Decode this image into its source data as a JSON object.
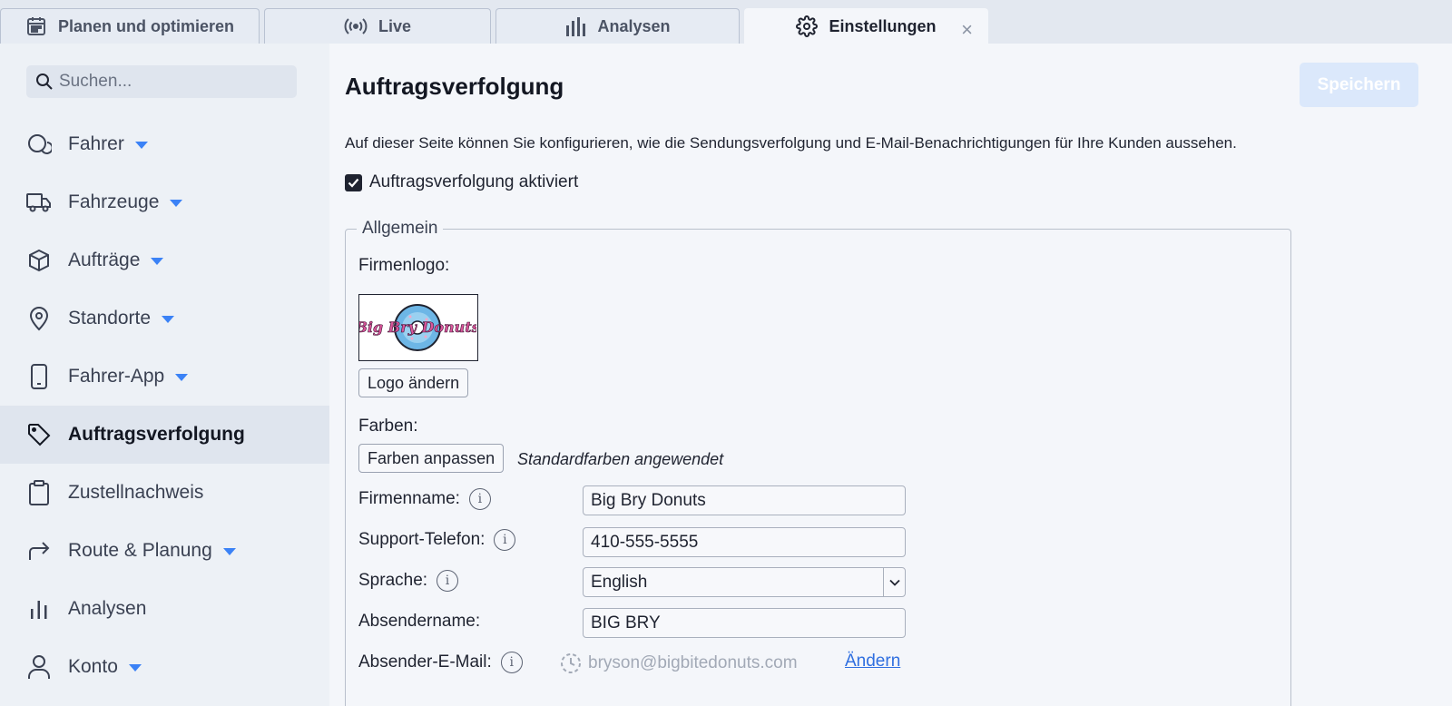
{
  "tabs": [
    {
      "label": "Planen und optimieren",
      "icon": "calendar-icon"
    },
    {
      "label": "Live",
      "icon": "broadcast-icon"
    },
    {
      "label": "Analysen",
      "icon": "bar-chart-icon"
    },
    {
      "label": "Einstellungen",
      "icon": "gear-icon",
      "active": true,
      "close": "×"
    }
  ],
  "sidebar": {
    "search_placeholder": "Suchen...",
    "items": [
      {
        "label": "Fahrer",
        "icon": "driver-icon",
        "expandable": true
      },
      {
        "label": "Fahrzeuge",
        "icon": "truck-icon",
        "expandable": true
      },
      {
        "label": "Aufträge",
        "icon": "box-icon",
        "expandable": true
      },
      {
        "label": "Standorte",
        "icon": "map-pin-icon",
        "expandable": true
      },
      {
        "label": "Fahrer-App",
        "icon": "phone-icon",
        "expandable": true
      },
      {
        "label": "Auftragsverfolgung",
        "icon": "tag-icon",
        "active": true
      },
      {
        "label": "Zustellnachweis",
        "icon": "clipboard-icon"
      },
      {
        "label": "Route & Planung",
        "icon": "route-arrow-icon",
        "expandable": true
      },
      {
        "label": "Analysen",
        "icon": "bar-chart-icon"
      },
      {
        "label": "Konto",
        "icon": "user-icon",
        "expandable": true
      }
    ]
  },
  "main": {
    "title": "Auftragsverfolgung",
    "save_label": "Speichern",
    "intro": "Auf dieser Seite können Sie konfigurieren, wie die Sendungsverfolgung und E-Mail-Benachrichtigungen für Ihre Kunden aussehen.",
    "enable_label": "Auftragsverfolgung aktiviert",
    "enable_checked": true,
    "group": {
      "legend": "Allgemein",
      "logo_label": "Firmenlogo:",
      "logo_text": "Big Bry Donuts",
      "change_logo_label": "Logo ändern",
      "colors_label": "Farben:",
      "customize_colors_label": "Farben anpassen",
      "colors_note": "Standardfarben angewendet",
      "company_name_label": "Firmenname:",
      "company_name_value": "Big Bry Donuts",
      "support_phone_label": "Support-Telefon:",
      "support_phone_value": "410-555-5555",
      "language_label": "Sprache:",
      "language_value": "English",
      "sender_name_label": "Absendername:",
      "sender_name_value": "BIG BRY",
      "sender_email_label": "Absender-E-Mail:",
      "sender_email_value": "bryson@bigbitedonuts.com",
      "change_email_label": "Ändern"
    }
  },
  "colors": {
    "accent": "#3b82f6",
    "save_disabled": "#dbe8fb",
    "link": "#2f6fe0"
  }
}
